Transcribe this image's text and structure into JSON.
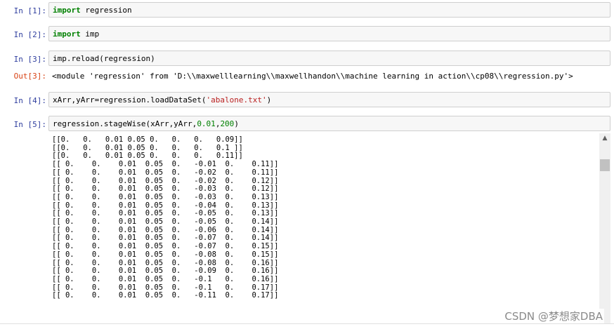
{
  "cells": [
    {
      "prompt": "In  [1]:",
      "code": [
        {
          "text": "import",
          "cls": "kw"
        },
        {
          "text": " regression",
          "cls": ""
        }
      ]
    },
    {
      "prompt": "In  [2]:",
      "code": [
        {
          "text": "import",
          "cls": "kw"
        },
        {
          "text": " imp",
          "cls": ""
        }
      ]
    },
    {
      "prompt": "In  [3]:",
      "code": [
        {
          "text": "imp.reload(regression)",
          "cls": ""
        }
      ]
    },
    {
      "prompt": "In  [4]:",
      "code": [
        {
          "text": "xArr,yArr=regression.loadDataSet(",
          "cls": ""
        },
        {
          "text": "'abalone.txt'",
          "cls": "str"
        },
        {
          "text": ")",
          "cls": ""
        }
      ]
    },
    {
      "prompt": "In  [5]:",
      "code": [
        {
          "text": "regression.stageWise(xArr,yArr,",
          "cls": ""
        },
        {
          "text": "0.01",
          "cls": "num"
        },
        {
          "text": ",",
          "cls": ""
        },
        {
          "text": "200",
          "cls": "num"
        },
        {
          "text": ")",
          "cls": ""
        }
      ]
    }
  ],
  "out3": {
    "prompt": "Out[3]:",
    "text": "<module 'regression' from 'D:\\\\maxwelllearning\\\\maxwellhandon\\\\machine learning in action\\\\cp08\\\\regression.py'>"
  },
  "output_lines": [
    "[[0.   0.   0.01 0.05 0.   0.   0.   0.09]]",
    "[[0.   0.   0.01 0.05 0.   0.   0.   0.1 ]]",
    "[[0.   0.   0.01 0.05 0.   0.   0.   0.11]]",
    "[[ 0.    0.    0.01  0.05  0.   -0.01  0.    0.11]]",
    "[[ 0.    0.    0.01  0.05  0.   -0.02  0.    0.11]]",
    "[[ 0.    0.    0.01  0.05  0.   -0.02  0.    0.12]]",
    "[[ 0.    0.    0.01  0.05  0.   -0.03  0.    0.12]]",
    "[[ 0.    0.    0.01  0.05  0.   -0.03  0.    0.13]]",
    "[[ 0.    0.    0.01  0.05  0.   -0.04  0.    0.13]]",
    "[[ 0.    0.    0.01  0.05  0.   -0.05  0.    0.13]]",
    "[[ 0.    0.    0.01  0.05  0.   -0.05  0.    0.14]]",
    "[[ 0.    0.    0.01  0.05  0.   -0.06  0.    0.14]]",
    "[[ 0.    0.    0.01  0.05  0.   -0.07  0.    0.14]]",
    "[[ 0.    0.    0.01  0.05  0.   -0.07  0.    0.15]]",
    "[[ 0.    0.    0.01  0.05  0.   -0.08  0.    0.15]]",
    "[[ 0.    0.    0.01  0.05  0.   -0.08  0.    0.16]]",
    "[[ 0.    0.    0.01  0.05  0.   -0.09  0.    0.16]]",
    "[[ 0.    0.    0.01  0.05  0.   -0.1   0.    0.16]]",
    "[[ 0.    0.    0.01  0.05  0.   -0.1   0.    0.17]]",
    "[[ 0.    0.    0.01  0.05  0.   -0.11  0.    0.17]]"
  ],
  "scrollbar": {
    "up_arrow_icon": "chevron-up-icon"
  },
  "watermark": "CSDN @梦想家DBA",
  "colors": {
    "prompt_in": "#303f9f",
    "prompt_out": "#d84315",
    "keyword": "#008000",
    "string": "#ba2121",
    "number": "#008000",
    "cell_background": "#f7f7f7",
    "cell_border": "#cfcfcf"
  }
}
